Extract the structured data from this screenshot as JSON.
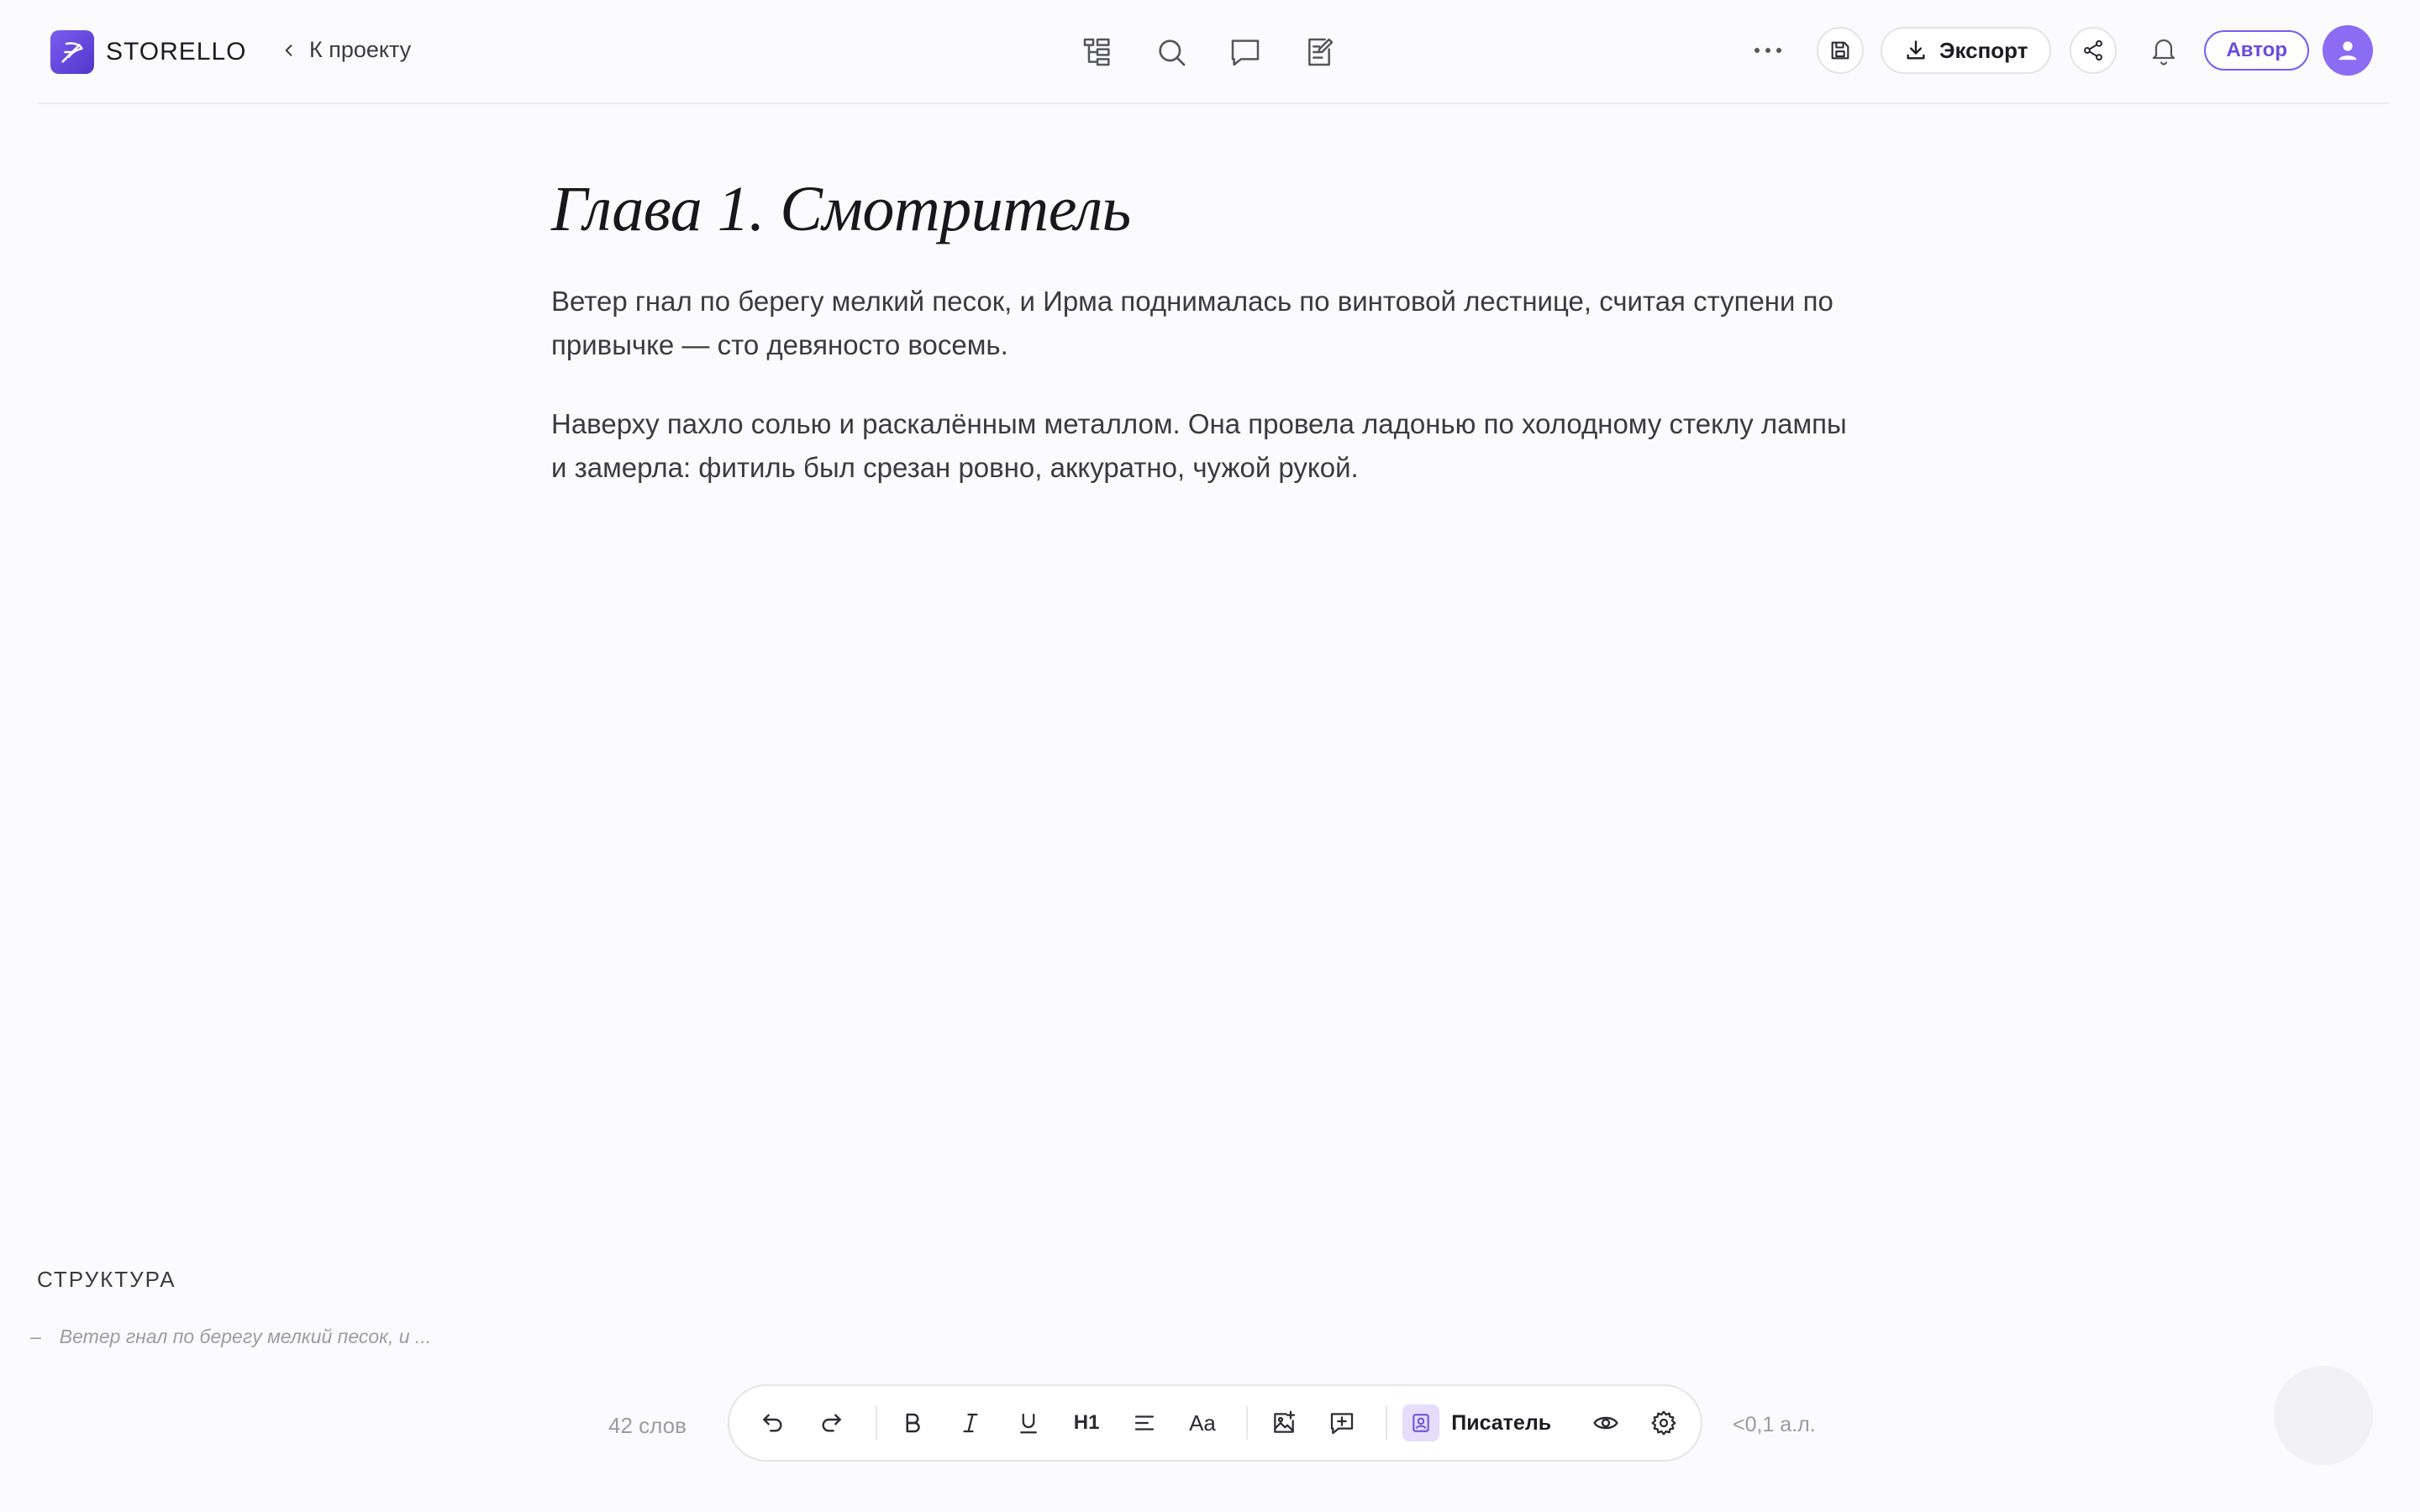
{
  "header": {
    "logo_text": "STORELLO",
    "back_label": "К проекту",
    "center_tools": [
      "structure-icon",
      "search-icon",
      "comment-icon",
      "notes-icon"
    ],
    "export_label": "Экспорт",
    "role_label": "Автор"
  },
  "document": {
    "title": "Глава 1. Смотритель",
    "paragraphs": [
      "Ветер гнал по берегу мелкий песок, и Ирма поднималась по винтовой лестнице, считая ступени по привычке — сто девяносто восемь.",
      "Наверху пахло солью и раскалённым металлом. Она провела ладонью по холодному стеклу лампы и замерла: фитиль был срезан ровно, аккуратно, чужой рукой."
    ]
  },
  "structure": {
    "title": "СТРУКТУРА",
    "items": [
      {
        "dash": "–",
        "text": "Ветер гнал по берегу мелкий песок, и ..."
      }
    ]
  },
  "footer": {
    "word_count": "42 слов",
    "heading_label": "H1",
    "font_label": "Aa",
    "writer_mode": "Писатель",
    "sheets": "<0,1 а.л."
  },
  "colors": {
    "accent": "#7b5cf0",
    "background": "#fbfbfd"
  }
}
